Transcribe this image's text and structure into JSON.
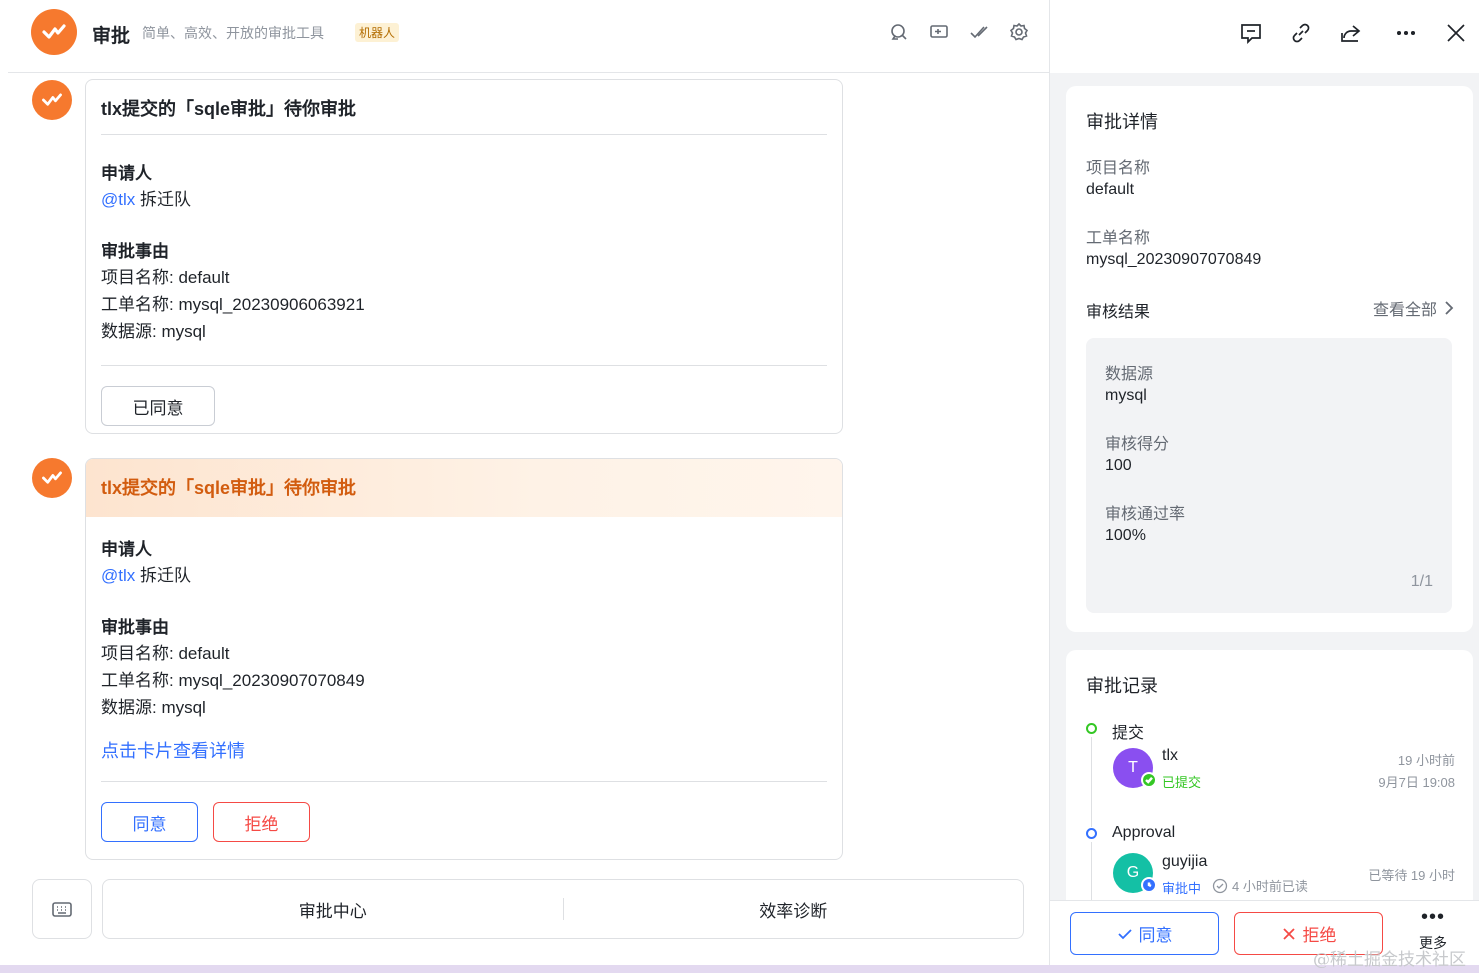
{
  "header": {
    "title": "审批",
    "subtitle": "简单、高效、开放的审批工具",
    "badge": "机器人",
    "icons": [
      "search-icon",
      "window-add-icon",
      "check-all-icon",
      "settings-icon"
    ]
  },
  "cards": [
    {
      "title": "tlx提交的「sqle审批」待你审批",
      "applicant_label": "申请人",
      "applicant_mention": "@tlx",
      "applicant_team": "拆迁队",
      "reason_label": "审批事由",
      "project": "项目名称: default",
      "ticket": "工单名称: mysql_20230906063921",
      "datasource": "数据源: mysql",
      "approved_label": "已同意"
    },
    {
      "title": "tlx提交的「sqle审批」待你审批",
      "applicant_label": "申请人",
      "applicant_mention": "@tlx",
      "applicant_team": "拆迁队",
      "reason_label": "审批事由",
      "project": "项目名称: default",
      "ticket": "工单名称: mysql_20230907070849",
      "datasource": "数据源: mysql",
      "detail_link": "点击卡片查看详情",
      "agree_label": "同意",
      "reject_label": "拒绝"
    }
  ],
  "bottom_menu": {
    "items": [
      "审批中心",
      "效率诊断"
    ]
  },
  "panel": {
    "top_icons": [
      "comment-icon",
      "link-icon",
      "share-icon",
      "more-icon",
      "close-icon"
    ],
    "detail": {
      "title": "审批详情",
      "project_label": "项目名称",
      "project_value": "default",
      "ticket_label": "工单名称",
      "ticket_value": "mysql_20230907070849",
      "result_label": "审核结果",
      "view_all": "查看全部",
      "result": {
        "datasource_label": "数据源",
        "datasource_value": "mysql",
        "score_label": "审核得分",
        "score_value": "100",
        "pass_label": "审核通过率",
        "pass_value": "100%",
        "pager": "1/1"
      }
    },
    "records": {
      "title": "审批记录",
      "steps": [
        {
          "step": "提交",
          "user": "tlx",
          "initial": "T",
          "status": "已提交",
          "time_ago": "19 小时前",
          "time": "9月7日 19:08"
        },
        {
          "step": "Approval",
          "user": "guyijia",
          "initial": "G",
          "status": "审批中",
          "read": "4 小时前已读",
          "waiting": "已等待 19 小时"
        }
      ]
    },
    "footer": {
      "agree": "同意",
      "reject": "拒绝",
      "more": "更多"
    }
  },
  "watermark": "@稀土掘金技术社区",
  "colors": {
    "brand_orange": "#f6792e",
    "accent_blue": "#3370ff",
    "danger_red": "#f54a45",
    "success_green": "#34c724"
  }
}
